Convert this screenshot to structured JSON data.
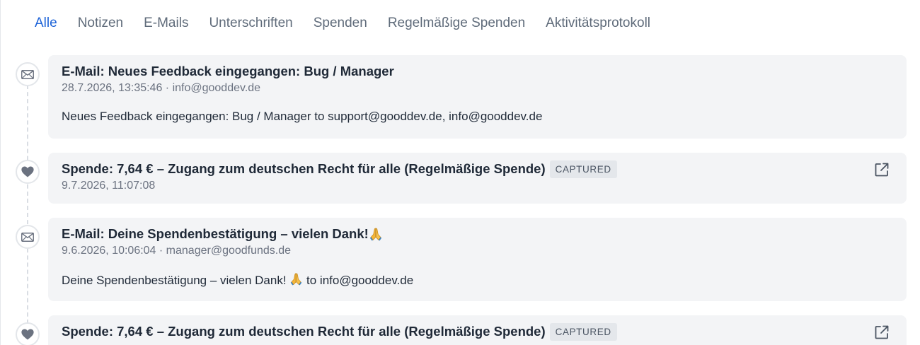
{
  "tabs": [
    "Alle",
    "Notizen",
    "E-Mails",
    "Unterschriften",
    "Spenden",
    "Regelmäßige Spenden",
    "Aktivitätsprotokoll"
  ],
  "active_tab": "Alle",
  "icons": {
    "email": "envelope-icon",
    "donation": "heart-icon",
    "external": "external-link-icon",
    "emoji": "folded-hands-icon"
  },
  "colors": {
    "accent": "#1d63d8",
    "card_bg": "#f3f4f6",
    "badge_bg": "#e4e7eb"
  },
  "timeline": [
    {
      "type": "email",
      "title": "E-Mail: Neues Feedback eingegangen: Bug / Manager",
      "meta": "28.7.2026, 13:35:46 · info@gooddev.de",
      "body": "Neues Feedback eingegangen: Bug / Manager to support@gooddev.de, info@gooddev.de"
    },
    {
      "type": "donation",
      "title": "Spende: 7,64 € – Zugang zum deutschen Recht für alle (Regelmäßige Spende)",
      "badge": "CAPTURED",
      "meta": "9.7.2026, 11:07:08"
    },
    {
      "type": "email",
      "title": "E-Mail: Deine Spendenbestätigung – vielen Dank! ",
      "meta": "9.6.2026, 10:06:04 · manager@goodfunds.de",
      "body": "Deine Spendenbestätigung – vielen Dank! ",
      "body_suffix": " to info@gooddev.de"
    },
    {
      "type": "donation",
      "title": "Spende: 7,64 € – Zugang zum deutschen Recht für alle (Regelmäßige Spende)",
      "badge": "CAPTURED"
    }
  ]
}
